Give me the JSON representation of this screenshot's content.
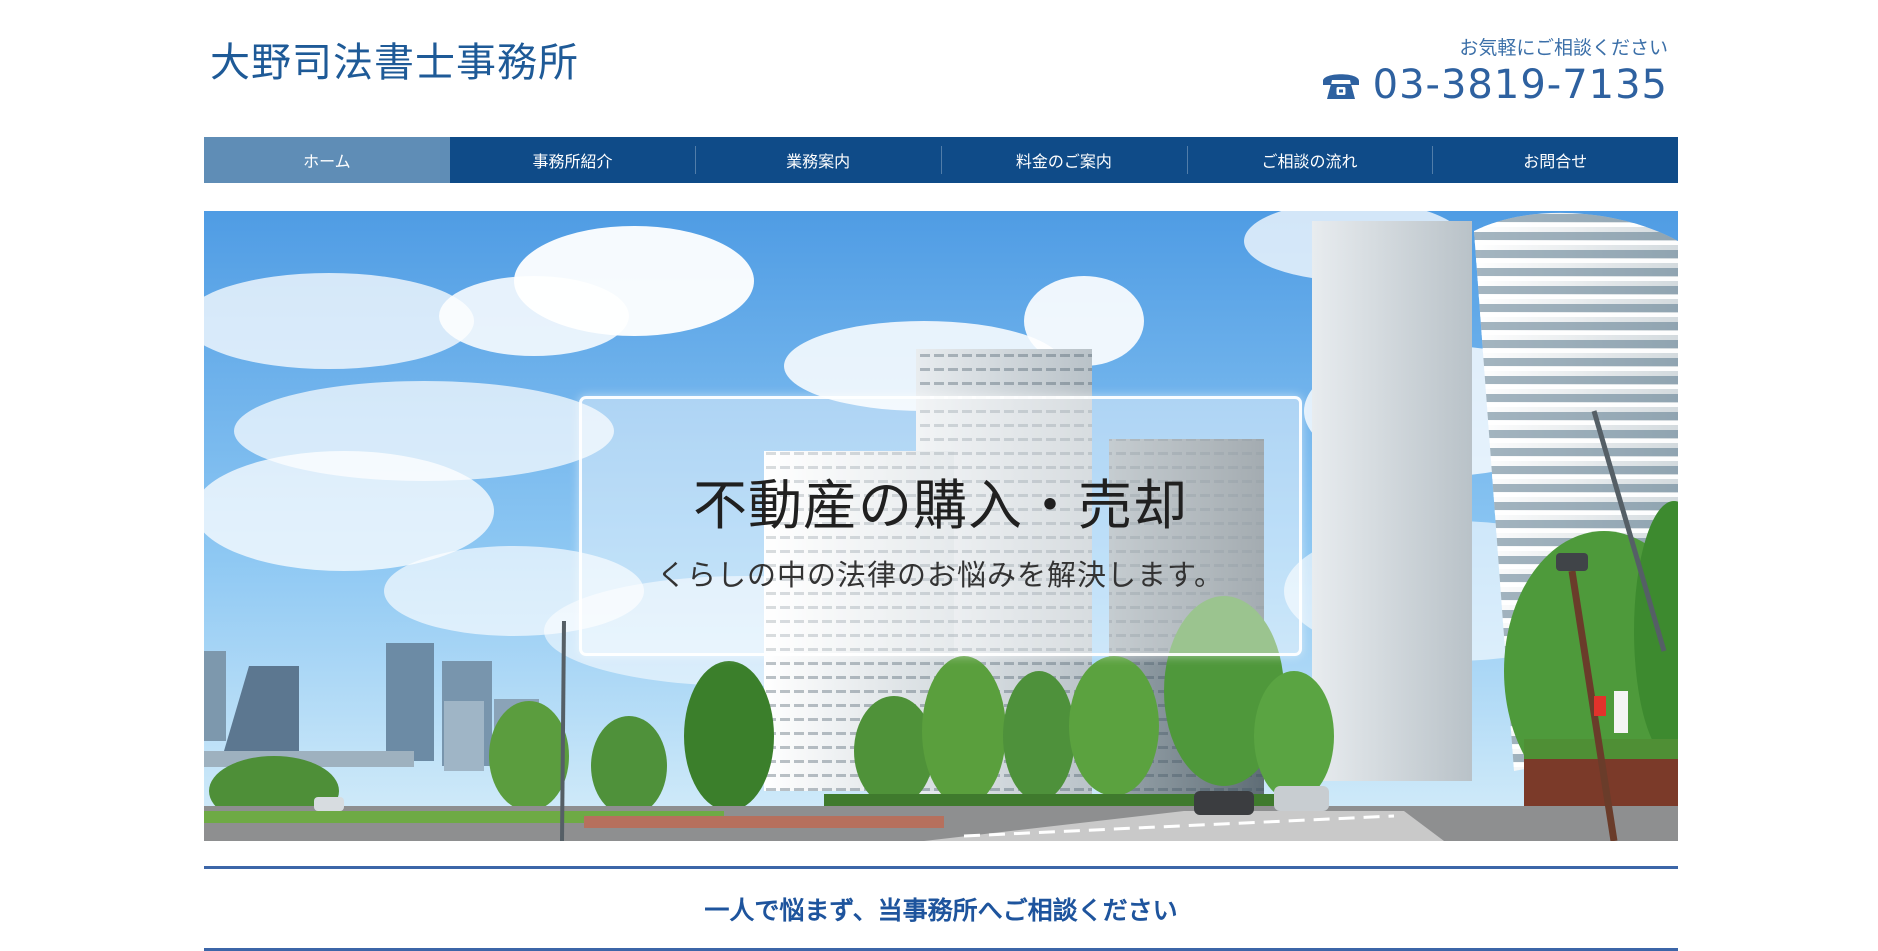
{
  "header": {
    "logo_text": "大野司法書士事務所",
    "contact_label": "お気軽にご相談ください",
    "phone_number": "03-3819-7135",
    "phone_icon": "telephone-icon"
  },
  "nav": {
    "items": [
      {
        "label": "ホーム",
        "active": true
      },
      {
        "label": "事務所紹介",
        "active": false
      },
      {
        "label": "業務案内",
        "active": false
      },
      {
        "label": "料金のご案内",
        "active": false
      },
      {
        "label": "ご相談の流れ",
        "active": false
      },
      {
        "label": "お問合せ",
        "active": false
      }
    ]
  },
  "hero": {
    "title": "不動産の購入・売却",
    "subtitle": "くらしの中の法律のお悩みを解決します。"
  },
  "section": {
    "heading": "一人で悩まず、当事務所へご相談ください"
  },
  "colors": {
    "nav_background": "#0f4b88",
    "nav_active": "#5f8db6",
    "heading_text": "#1e549d",
    "divider": "#3c66a8"
  }
}
